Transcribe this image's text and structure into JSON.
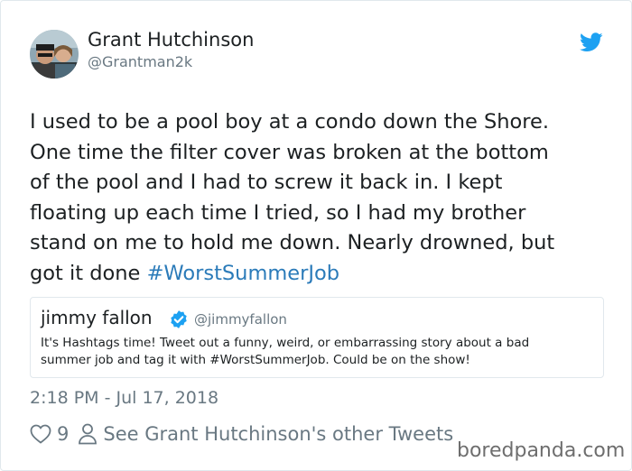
{
  "author": {
    "name": "Grant Hutchinson",
    "handle": "@Grantman2k"
  },
  "tweet": {
    "lines": [
      "I used to be a pool boy at a condo down the Shore.",
      "One time the filter cover was broken at the bottom",
      "of the pool and I had to screw it back in. I kept",
      "floating up each time I tried, so I had my brother",
      "stand on me to hold me down. Nearly drowned, but"
    ],
    "last_line": "got it done ",
    "hashtag": "#WorstSummerJob"
  },
  "quoted_tweet": {
    "name": "jimmy fallon",
    "handle": "@jimmyfallon",
    "text_line1": "It's Hashtags time! Tweet out a funny, weird, or embarrassing story about a bad",
    "text_line2": "summer job and tag it with #WorstSummerJob. Could be on the show!"
  },
  "timestamp": "2:18 PM - Jul 17, 2018",
  "actions": {
    "likes": "9",
    "see_more": "See Grant Hutchinson's other Tweets"
  },
  "watermark": "boredpanda.com",
  "colors": {
    "link": "#2b7bb9",
    "secondary_text": "#697882",
    "twitter_blue": "#1da1f2",
    "border": "#e1e8ed"
  },
  "icons": [
    "avatar",
    "twitter-bird-icon",
    "verified-badge-icon",
    "heart-icon",
    "person-icon"
  ]
}
